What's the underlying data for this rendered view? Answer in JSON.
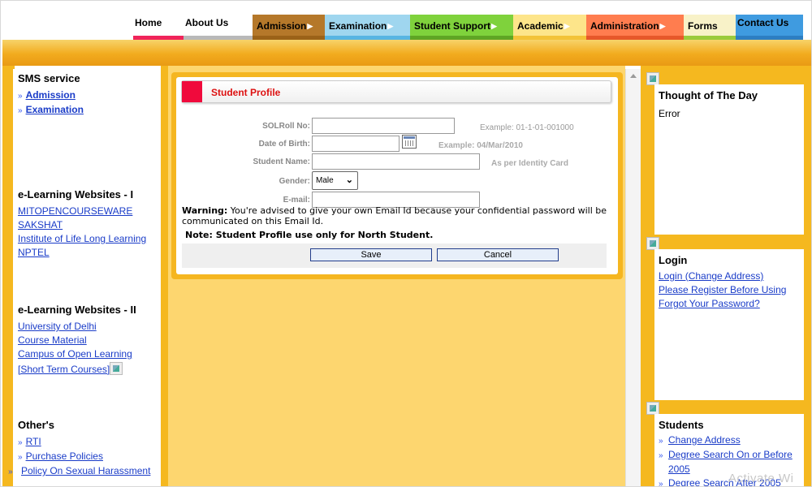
{
  "nav": {
    "items": [
      {
        "label": "Home",
        "bg": "#ffffff",
        "stripe": "#f0245a",
        "fg": "#000000",
        "arrow": false
      },
      {
        "label": "About Us",
        "bg": "#ffffff",
        "stripe": "#b9b9b9",
        "fg": "#000000",
        "arrow": false
      },
      {
        "label": "Admission",
        "bg": "#b5782a",
        "stripe": "#9b6218",
        "fg": "#000000",
        "arrow": true
      },
      {
        "label": "Examination",
        "bg": "#9fd6ef",
        "stripe": "#58b5e2",
        "fg": "#000000",
        "arrow": true
      },
      {
        "label": "Student Support",
        "bg": "#7fd23c",
        "stripe": "#5fa524",
        "fg": "#000000",
        "arrow": true
      },
      {
        "label": "Academic",
        "bg": "#fde58a",
        "stripe": "#f3c338",
        "fg": "#000000",
        "arrow": true
      },
      {
        "label": "Administration",
        "bg": "#ff7d4f",
        "stripe": "#e6582a",
        "fg": "#000000",
        "arrow": true
      },
      {
        "label": "Forms",
        "bg": "#f8f2c8",
        "stripe": "#9bcb3c",
        "fg": "#000000",
        "arrow": false
      },
      {
        "label": "Contact Us",
        "bg": "#3f9be0",
        "stripe": "#2d7ec2",
        "fg": "#000000",
        "arrow": false
      }
    ]
  },
  "left": {
    "sms": {
      "title": "SMS service",
      "links": [
        "Admission",
        "Examination"
      ]
    },
    "elearn1": {
      "title": "e-Learning Websites - I",
      "links": [
        "MITOPENCOURSEWARE",
        "SAKSHAT",
        "Institute of Life Long Learning",
        "NPTEL"
      ]
    },
    "elearn2": {
      "title": "e-Learning Websites - II",
      "links": [
        "University of Delhi",
        "Course Material",
        "Campus of Open Learning",
        "[Short Term Courses]"
      ]
    },
    "others": {
      "title": "Other's",
      "links": [
        "RTI",
        "Purchase Policies",
        "Policy On Sexual Harassment"
      ]
    }
  },
  "profile": {
    "title": "Student Profile",
    "solroll": {
      "label": "SOLRoll No:",
      "value": "",
      "hint": "Example: 01-1-01-001000"
    },
    "dob": {
      "label": "Date of Birth:",
      "value": "",
      "hint": "Example: 04/Mar/2010"
    },
    "name": {
      "label": "Student Name:",
      "value": "",
      "hint": "As per Identity Card"
    },
    "gender": {
      "label": "Gender:",
      "value": "Male"
    },
    "email": {
      "label": "E-mail:",
      "value": ""
    },
    "warning_bold": "Warning:",
    "warning_text": " You're advised to give your own Email Id because your confidential password will be  communicated on this Email Id.",
    "note": "Note: Student Profile use only for North Student.",
    "save_label": "Save",
    "cancel_label": "Cancel"
  },
  "right": {
    "thought": {
      "title": "Thought of The Day",
      "text": "Error"
    },
    "login": {
      "title": "Login",
      "links": [
        "Login (Change Address)",
        "Please Register Before Using",
        "Forgot Your Password?"
      ]
    },
    "students": {
      "title": "Students",
      "links": [
        "Change Address",
        "Degree Search On or Before 2005",
        "Degree Search After 2005"
      ]
    }
  },
  "watermark": "Activate Wi"
}
